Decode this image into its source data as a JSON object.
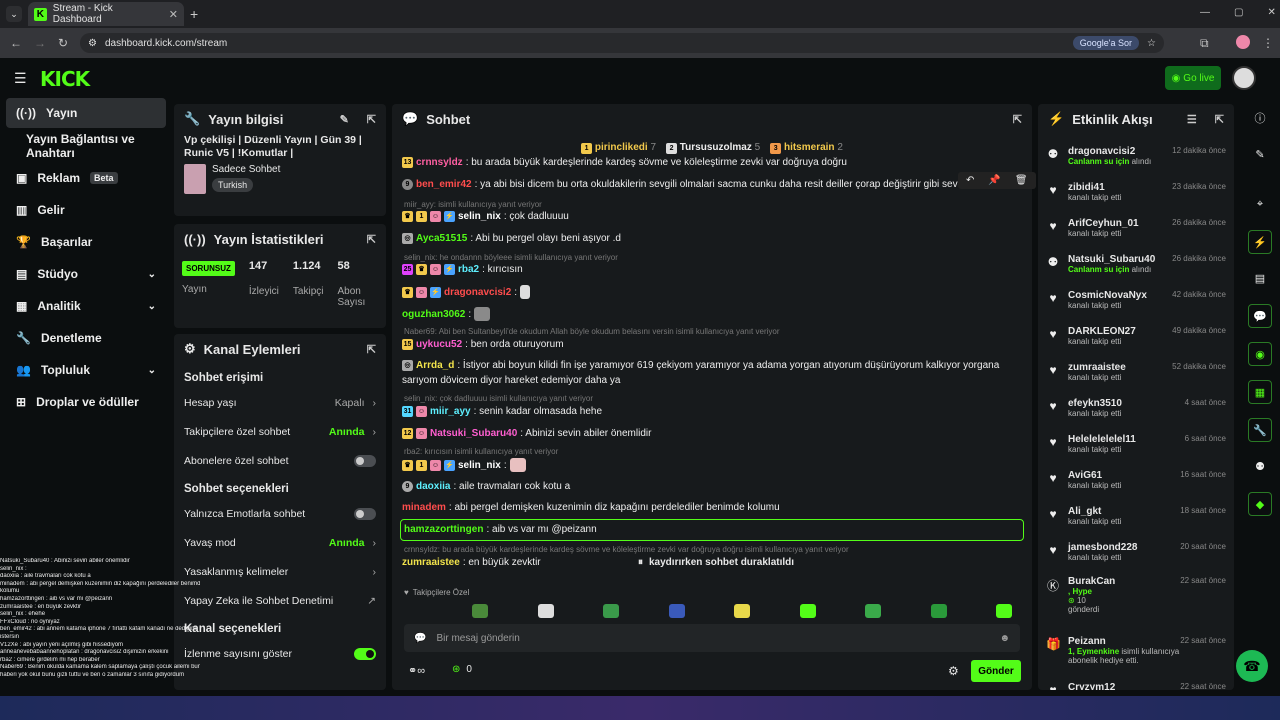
{
  "browser": {
    "tab_title": "Stream - Kick Dashboard",
    "url": "dashboard.kick.com/stream",
    "google_btn": "Google'a Sor"
  },
  "header": {
    "logo": "KICK",
    "golive": "Go live"
  },
  "sidebar": {
    "items": [
      {
        "label": "Yayın"
      },
      {
        "label": "Yayın Bağlantısı ve Anahtarı"
      },
      {
        "label": "Reklam",
        "badge": "Beta"
      },
      {
        "label": "Gelir"
      },
      {
        "label": "Başarılar"
      },
      {
        "label": "Stüdyo"
      },
      {
        "label": "Analitik"
      },
      {
        "label": "Denetleme"
      },
      {
        "label": "Topluluk"
      },
      {
        "label": "Droplar ve ödüller"
      }
    ]
  },
  "stream_info": {
    "title": "Yayın bilgisi",
    "stream_title": "Vp çekilişi | Düzenli Yayın | Gün 39 | Runic V5 | !Komutlar |",
    "category": "Sadece Sohbet",
    "language": "Turkish"
  },
  "stream_stats": {
    "title": "Yayın İstatistikleri",
    "status": "SORUNSUZ",
    "status_label": "Yayın",
    "viewers": "147",
    "viewers_label": "İzleyici",
    "followers": "1.124",
    "followers_label": "Takipçi",
    "subs": "58",
    "subs_label": "Abon Sayısı"
  },
  "channel_actions": {
    "title": "Kanal Eylemleri",
    "chat_access": "Sohbet erişimi",
    "account_age": "Hesap yaşı",
    "account_age_val": "Kapalı",
    "followers_only": "Takipçilere özel sohbet",
    "followers_only_val": "Anında",
    "subs_only": "Abonelere özel sohbet",
    "chat_options": "Sohbet seçenekleri",
    "emote_only": "Yalnızca Emotlarla sohbet",
    "slow_mode": "Yavaş mod",
    "slow_mode_val": "Anında",
    "banned_words": "Yasaklanmış kelimeler",
    "ai_mod": "Yapay Zeka ile Sohbet Denetimi",
    "channel_options": "Kanal seçenekleri",
    "show_viewers": "İzlenme sayısını göster"
  },
  "chat": {
    "title": "Sohbet",
    "pinned": [
      {
        "name": "pirinclikedi",
        "n": "7"
      },
      {
        "name": "Tursusuzolmaz",
        "n": "5"
      },
      {
        "name": "hitsmerain",
        "n": "2"
      }
    ],
    "messages": [
      {
        "user": "crnnsyldz",
        "color": "#ff5fa2",
        "text": ": bu arada büyük kardeşlerinde kardeş sövme ve köleleştirme zevki var doğruya doğru"
      },
      {
        "user": "ben_emir42",
        "color": "#ff4d4d",
        "text": ": ya abi bisi dicem bu orta okuldakilerin sevgili olmalari sacma cunku daha resit deiller çorap değiştirir gibi sev"
      },
      {
        "user": "selin_nix",
        "color": "#ffffff",
        "text": ": çok dadluuuu",
        "reply": "miir_ayy:  isimli kullanıcıya yanıt veriyor"
      },
      {
        "user": "Ayca51515",
        "color": "#53fc18",
        "text": ": Abi bu pergel olayı beni aşıyor .d"
      },
      {
        "user": "rba2",
        "color": "#5ef0ff",
        "text": ": kırıcısın",
        "reply": "selin_nix: he ondannn böyleee isimli kullanıcıya yanıt veriyor"
      },
      {
        "user": "dragonavcisi2",
        "color": "#ff4d4d",
        "text": ":"
      },
      {
        "user": "oguzhan3062",
        "color": "#53fc18",
        "text": ":"
      },
      {
        "user": "uykucu52",
        "color": "#ff5fd0",
        "text": ": ben orda oturuyorum",
        "reply": "Naber69: Abi ben Sultanbeyli'de okudum Allah böyle okudum belasını versin isimli kullanıcıya yanıt veriyor"
      },
      {
        "user": "Arrda_d",
        "color": "#f2e44c",
        "text": ": İstiyor abi boyun kilidi fin işe yaramıyor 619 çekiyom yaramıyor ya adama yorgan atıyorum düşürüyorum kalkıyor yorgana"
      },
      {
        "user": "",
        "color": "#eee",
        "text": "sarıyom dövicem diyor hareket edemiyor daha ya"
      },
      {
        "user": "miir_ayy",
        "color": "#5ef0ff",
        "text": ": senin kadar olmasada hehe",
        "reply": "selin_nix: çok dadluuuu isimli kullanıcıya yanıt veriyor"
      },
      {
        "user": "Natsuki_Subaru40",
        "color": "#ff5fd0",
        "text": ": Abinizi sevin abiler önemlidir"
      },
      {
        "user": "selin_nix",
        "color": "#ffffff",
        "text": ":",
        "reply": "rba2: kırıcısın isimli kullanıcıya yanıt veriyor"
      },
      {
        "user": "daoxiia",
        "color": "#5ef0ff",
        "text": ": aile travmaları cok kotu a"
      },
      {
        "user": "minadem",
        "color": "#ff4d4d",
        "text": ": abi pergel demişken kuzenimin diz kapağını perdelediler benimde kolumu"
      },
      {
        "user": "hamzazorttingen",
        "color": "#53fc18",
        "text": ": aib vs var mı @peizann"
      },
      {
        "user": "zumraaistee",
        "color": "#f2e44c",
        "text": ": en büyük zevktir",
        "reply": "crnnsyldz: bu arada büyük kardeşlerinde kardeş sövme ve köleleştirme zevki var doğruya doğru isimli kullanıcıya yanıt veriyor"
      }
    ],
    "paused": "kaydırırken sohbet duraklatıldı",
    "followers_tab": "Takipçilere Özel",
    "input_placeholder": "Bir mesaj gönderin",
    "points": "0",
    "send": "Gönder"
  },
  "events": {
    "title": "Etkinlik Akışı",
    "items": [
      {
        "name": "dragonavcisi2",
        "sub": "Canlanm su için",
        "sub2": "alındı",
        "time": "12 dakika önce",
        "green": true
      },
      {
        "name": "zibidi41",
        "sub": "kanalı takip etti",
        "time": "23 dakika önce"
      },
      {
        "name": "ArifCeyhun_01",
        "sub": "kanalı takip etti",
        "time": "26 dakika önce"
      },
      {
        "name": "Natsuki_Subaru40",
        "sub": "Canlanm su için",
        "sub2": "alındı",
        "time": "26 dakika önce",
        "green": true
      },
      {
        "name": "CosmicNovaNyx",
        "sub": "kanalı takip etti",
        "time": "42 dakika önce"
      },
      {
        "name": "DARKLEON27",
        "sub": "kanalı takip etti",
        "time": "49 dakika önce"
      },
      {
        "name": "zumraaistee",
        "sub": "kanalı takip etti",
        "time": "52 dakika önce"
      },
      {
        "name": "efeykn3510",
        "sub": "kanalı takip etti",
        "time": "4 saat önce"
      },
      {
        "name": "Helelelelelel11",
        "sub": "kanalı takip etti",
        "time": "6 saat önce"
      },
      {
        "name": "AviG61",
        "sub": "kanalı takip etti",
        "time": "16 saat önce"
      },
      {
        "name": "Ali_gkt",
        "sub": "kanalı takip etti",
        "time": "18 saat önce"
      },
      {
        "name": "jamesbond228",
        "sub": "kanalı takip etti",
        "time": "20 saat önce"
      }
    ],
    "burak": {
      "name": "BurakCan",
      "hype": ", Hype",
      "n": "10",
      "gift": "gönderdi",
      "time": "22 saat önce"
    },
    "peizann": {
      "name": "Peizann",
      "line": "1, Eymenkine",
      "rest": " isimli kullanıcıya abonelik hediye etti.",
      "time": "22 saat önce"
    },
    "last": {
      "name": "Cryzym12",
      "time": "22 saat önce"
    }
  },
  "overlay": [
    "Natsuki_Subaru40 : Abinizi sevin abiler önemlidir",
    "selin_nix :",
    "daoxiia : aile travmaları cok kotu a",
    "minadem : abi pergel demişken kuzenimin diz kapağını perdelediler benimde",
    "kolumu",
    "hamzazorttingen : aib vs var mı @peizann",
    "zumraaistee : en büyük zevktir",
    "selin_nix : ehehe",
    "FFxCloud : no oyniyaz",
    "ben_emir42 : abi annem kafama iphone 7 fırlattı kafam kanadı ne dediğini",
    "istersin",
    "V12Xe : abi yayın yeni açılmış gibi hissediyom",
    "anneanevebabaannehoplatan : dragonavcisi2 dişimizin erkekini",
    "rba2 : cimere girdelim mi hep beraber",
    "Naber69 : Benim okulda kamama kalem saplamaya çalıştı çocuk ailemi bundan",
    "haberi yok okul bunu gizli tuttu ve ben o zamanlar 3 sınıfa gidiyordum"
  ]
}
